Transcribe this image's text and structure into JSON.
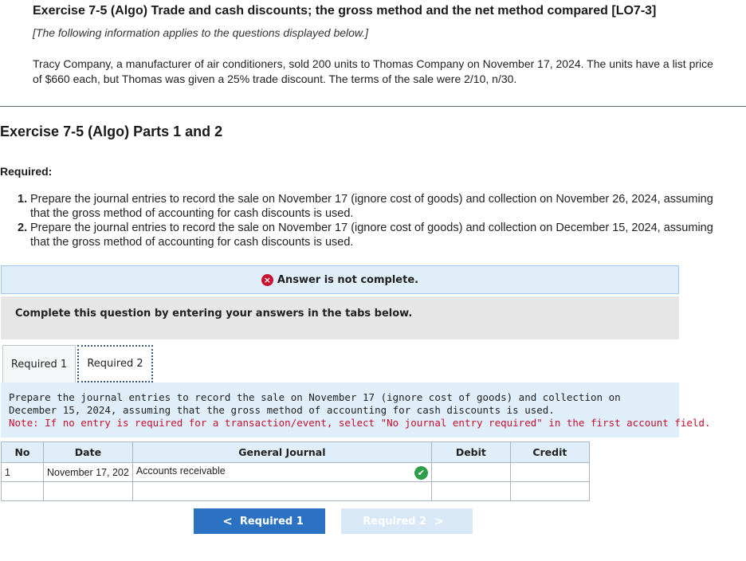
{
  "header": {
    "title": "Exercise 7-5 (Algo) Trade and cash discounts; the gross method and the net method compared [LO7-3]",
    "note": "[The following information applies to the questions displayed below.]",
    "body": "Tracy Company, a manufacturer of air conditioners, sold 200 units to Thomas Company on November 17, 2024. The units have a list price of $660 each, but Thomas was given a 25% trade discount. The terms of the sale were 2/10, n/30."
  },
  "parts_title": "Exercise 7-5 (Algo) Parts 1 and 2",
  "required": {
    "label": "Required:",
    "items": [
      {
        "num": "1.",
        "text": "Prepare the journal entries to record the sale on November 17 (ignore cost of goods) and collection on November 26, 2024, assuming that the gross method of accounting for cash discounts is used."
      },
      {
        "num": "2.",
        "text": "Prepare the journal entries to record the sale on November 17 (ignore cost of goods) and collection on December 15, 2024, assuming that the gross method of accounting for cash discounts is used."
      }
    ]
  },
  "status": {
    "icon": "×",
    "text": "Answer is not complete."
  },
  "instructions": "Complete this question by entering your answers in the tabs below.",
  "tabs": [
    {
      "label": "Required 1"
    },
    {
      "label": "Required 2"
    }
  ],
  "question": {
    "text": "Prepare the journal entries to record the sale on November 17 (ignore cost of goods) and collection on December 15, 2024, assuming that the gross method of accounting for cash discounts is used.",
    "note": "Note: If no entry is required for a transaction/event, select \"No journal entry required\" in the first account field."
  },
  "journal": {
    "headers": {
      "no": "No",
      "date": "Date",
      "general_journal": "General Journal",
      "debit": "Debit",
      "credit": "Credit"
    },
    "rows": [
      {
        "no": "1",
        "date": "November 17, 202",
        "account": "Accounts receivable",
        "debit": "",
        "credit": ""
      },
      {
        "no": "",
        "date": "",
        "account": "",
        "debit": "",
        "credit": ""
      }
    ]
  },
  "nav": {
    "prev_label": "Required 1",
    "next_label": "Required 2",
    "prev_chevron": "<",
    "next_chevron": ">"
  },
  "icons": {
    "check": "✔"
  },
  "colors": {
    "status_icon": "#c8102e",
    "note_red": "#c8102e",
    "check_green": "#2e9e4a",
    "prev_button": "#2b73c2",
    "next_button_disabled": "#d9e8f6",
    "banner_bg": "#dfeef9"
  }
}
